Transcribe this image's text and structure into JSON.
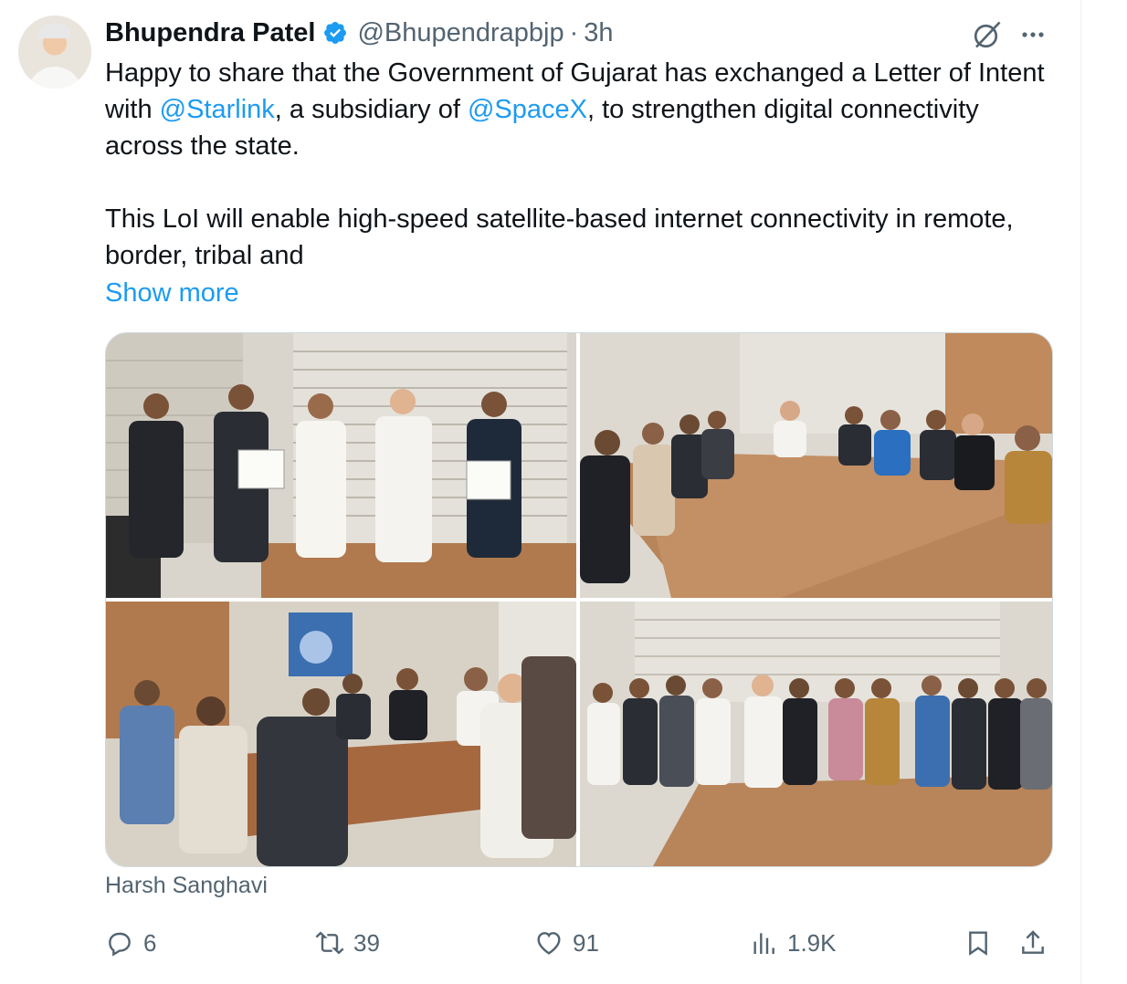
{
  "author": {
    "name": "Bhupendra Patel",
    "handle": "@Bhupendrapbjp",
    "separator": "·",
    "time": "3h",
    "verified": true
  },
  "tweet": {
    "text_1": "Happy to share that the Government of Gujarat has exchanged a Letter of Intent with ",
    "mention_1": "@Starlink",
    "text_2": ", a subsidiary of ",
    "mention_2": "@SpaceX",
    "text_3": ", to strengthen digital connectivity across the state.\n\nThis LoI will enable high-speed satellite-based internet connectivity in remote, border, tribal and",
    "show_more": "Show more"
  },
  "media": {
    "credit": "Harsh Sanghavi",
    "photos": [
      {
        "scene": "five men standing, two holding signed documents"
      },
      {
        "scene": "people seated around a long conference table"
      },
      {
        "scene": "meeting around a table with painting on wall"
      },
      {
        "scene": "group photo standing behind conference table"
      }
    ]
  },
  "actions": {
    "replies": "6",
    "reposts": "39",
    "likes": "91",
    "views": "1.9K"
  },
  "icons": {
    "verified": "verified-badge-icon",
    "grok": "grok-icon",
    "more": "more-icon",
    "reply": "reply-icon",
    "repost": "repost-icon",
    "like": "like-icon",
    "views": "views-icon",
    "bookmark": "bookmark-icon",
    "share": "share-icon"
  },
  "colors": {
    "accent": "#1d9bf0",
    "muted": "#536471",
    "text": "#0f1419"
  }
}
